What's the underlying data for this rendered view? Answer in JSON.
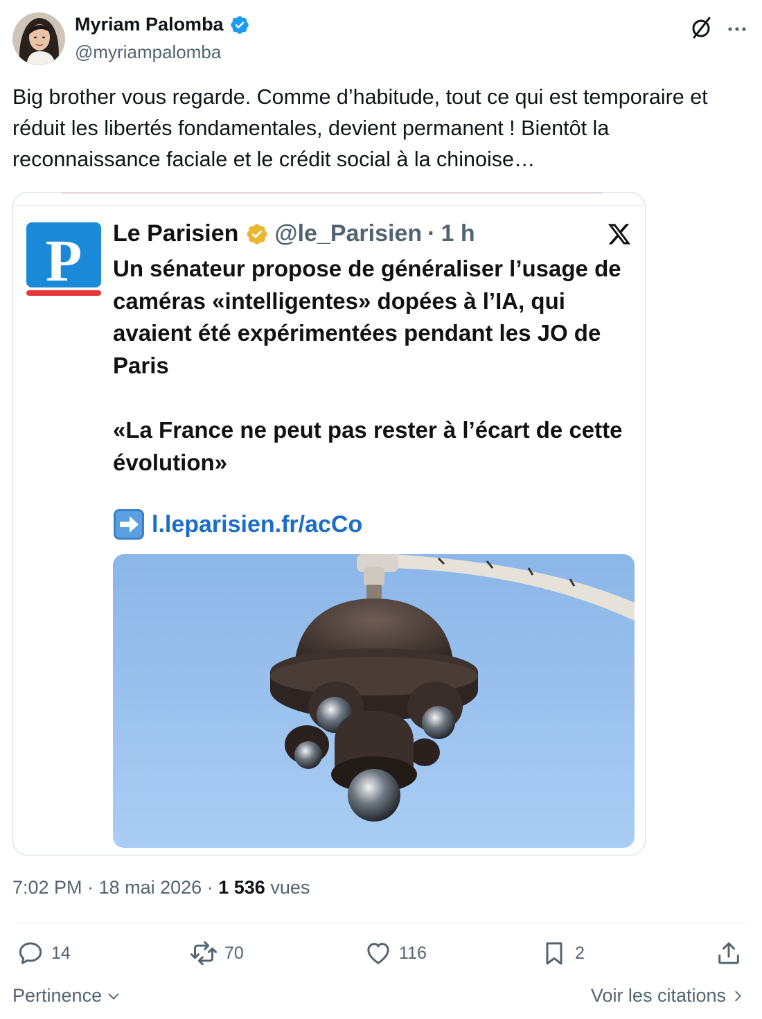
{
  "author": {
    "name": "Myriam Palomba",
    "handle": "@myriampalomba"
  },
  "tweet": {
    "text": "Big brother vous regarde. Comme d’habitude, tout ce qui est temporaire et réduit les libertés fondamentales, devient permanent ! Bientôt la reconnaissance faciale et le crédit social à la chinoise…"
  },
  "embedded_card": {
    "logo_letter": "P",
    "name": "Le Parisien",
    "handle": "@le_Parisien",
    "separator": "·",
    "time": "1 h",
    "headline": "Un sénateur propose de généraliser l’usage de caméras «intelligentes» dopées à l’IA, qui avaient été expérimentées pendant les JO de Paris",
    "quote": "«La France ne peut pas rester à l’écart de cette évolution»",
    "link": "l.leparisien.fr/acCo",
    "brand_blue": "#1a8ad8",
    "brand_red": "#e33b3b"
  },
  "meta": {
    "time": "7:02 PM",
    "date": "18 mai 2026",
    "dot1": "·",
    "dot2": "·",
    "views_count": "1 536",
    "views_label": "vues"
  },
  "actions": {
    "replies": "14",
    "retweets": "70",
    "likes": "116",
    "bookmarks": "2"
  },
  "footer": {
    "sort_label": "Pertinence",
    "quotes_label": "Voir les citations"
  },
  "icons": [
    "verified-badge-icon",
    "grok-icon",
    "more-icon",
    "x-logo-icon",
    "arrow-right-icon",
    "reply-icon",
    "retweet-icon",
    "like-icon",
    "bookmark-icon",
    "share-icon",
    "chevron-down-icon",
    "chevron-right-icon"
  ],
  "colors": {
    "accent": "#1d9bf0",
    "muted": "#536471",
    "text": "#0f1419",
    "gold_badge": "#e8b830"
  }
}
